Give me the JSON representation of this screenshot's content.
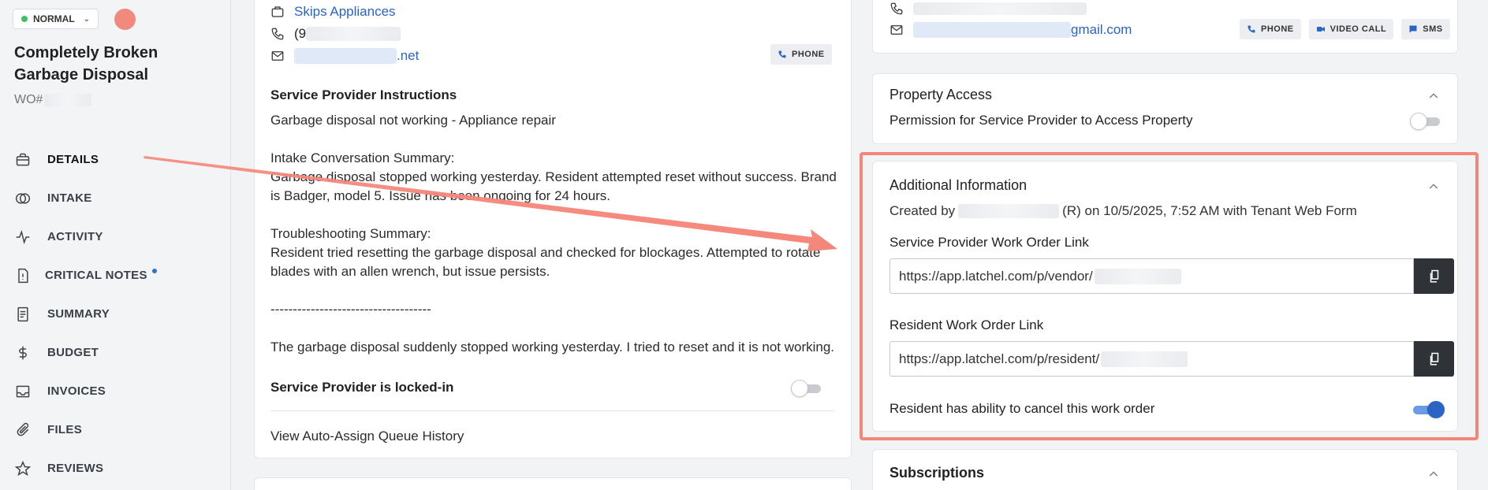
{
  "sidebar": {
    "priority_label": "NORMAL",
    "title": "Completely Broken Garbage Disposal",
    "wo_prefix": "WO#",
    "nav": [
      {
        "label": "DETAILS",
        "icon": "briefcase-icon"
      },
      {
        "label": "INTAKE",
        "icon": "intake-icon"
      },
      {
        "label": "ACTIVITY",
        "icon": "activity-icon"
      },
      {
        "label": "CRITICAL NOTES",
        "icon": "notes-icon"
      },
      {
        "label": "SUMMARY",
        "icon": "summary-icon"
      },
      {
        "label": "BUDGET",
        "icon": "dollar-icon"
      },
      {
        "label": "INVOICES",
        "icon": "invoice-icon"
      },
      {
        "label": "FILES",
        "icon": "paperclip-icon"
      },
      {
        "label": "REVIEWS",
        "icon": "star-icon"
      }
    ]
  },
  "provider": {
    "company": "Skips Appliances",
    "phone_prefix": "(9",
    "email_suffix": ".net",
    "phone_button": "PHONE",
    "instructions_heading": "Service Provider Instructions",
    "instructions_text": "Garbage disposal not working - Appliance repair\n\nIntake Conversation Summary:\nGarbage disposal stopped working yesterday. Resident attempted reset without success. Brand is Badger, model 5. Issue has been ongoing for 24 hours.\n\nTroubleshooting Summary:\nResident tried resetting the garbage disposal and checked for blockages. Attempted to rotate blades with an allen wrench, but issue persists.\n\n------------------------------------\n\nThe garbage disposal suddenly stopped working yesterday. I tried to reset and it is not working.",
    "locked_label": "Service Provider is locked-in",
    "queue_link": "View Auto-Assign Queue History"
  },
  "resident_contact": {
    "email_suffix": "gmail.com",
    "buttons": [
      "PHONE",
      "VIDEO CALL",
      "SMS"
    ]
  },
  "property_access": {
    "title": "Property Access",
    "permission_label": "Permission for Service Provider to Access Property",
    "permission_on": false
  },
  "additional_info": {
    "title": "Additional Information",
    "created_prefix": "Created by",
    "created_suffix": "(R) on 10/5/2025, 7:52 AM with Tenant Web Form",
    "sp_link_label": "Service Provider Work Order Link",
    "sp_link_value": "https://app.latchel.com/p/vendor/",
    "res_link_label": "Resident Work Order Link",
    "res_link_value": "https://app.latchel.com/p/resident/",
    "cancel_label": "Resident has ability to cancel this work order",
    "cancel_on": true
  },
  "subscriptions": {
    "title": "Subscriptions"
  },
  "colors": {
    "accent": "#2a64c5",
    "highlight": "#f5877a",
    "status_dot": "#3fbf6a"
  }
}
